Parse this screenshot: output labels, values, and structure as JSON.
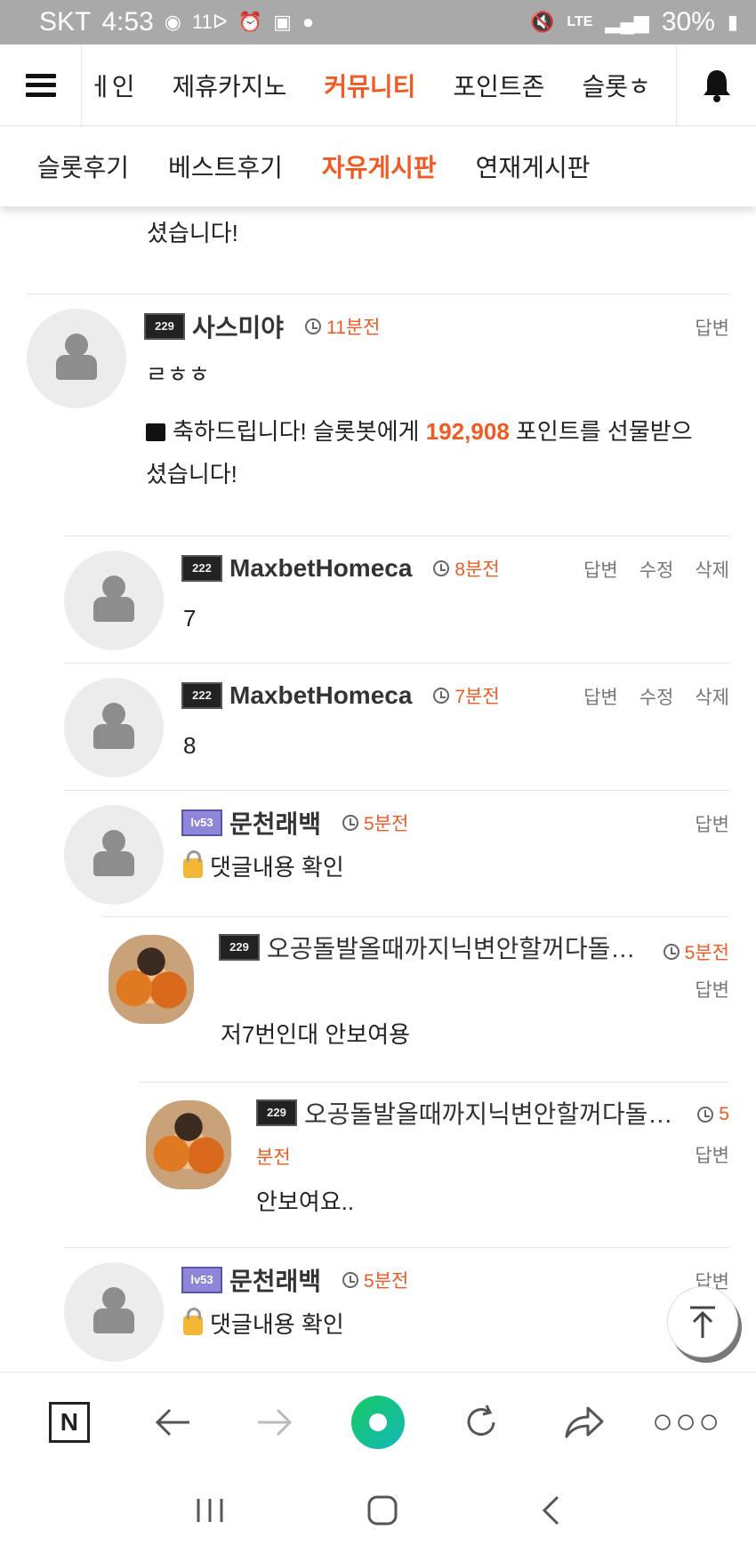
{
  "status_bar": {
    "carrier": "SKT",
    "time": "4:53",
    "extra": "11ᐅ",
    "network": "LTE",
    "battery": "30%"
  },
  "top_nav": {
    "items": [
      "ㅔ인",
      "제휴카지노",
      "커뮤니티",
      "포인트존",
      "슬롯ㅎ"
    ],
    "active": "커뮤니티"
  },
  "sub_nav": {
    "items": [
      "슬롯후기",
      "베스트후기",
      "자유게시판",
      "연재게시판"
    ],
    "active": "자유게시판"
  },
  "cut_top": {
    "line2": "셨습니다!"
  },
  "comments": [
    {
      "level_badge": "229",
      "nickname": "사스미야",
      "time": "11분전",
      "actions": [
        "답변"
      ],
      "text": "ㄹㅎㅎ",
      "gift_prefix": "축하드립니다! 슬롯봇에게 ",
      "gift_points": "192,908",
      "gift_suffix": " 포인트를 선물받으",
      "gift_line2": "셨습니다!"
    },
    {
      "level_badge": "222",
      "nickname": "MaxbetHomeca",
      "time": "8분전",
      "actions": [
        "답변",
        "수정",
        "삭제"
      ],
      "text": "7"
    },
    {
      "level_badge": "222",
      "nickname": "MaxbetHomeca",
      "time": "7분전",
      "actions": [
        "답변",
        "수정",
        "삭제"
      ],
      "text": "8"
    },
    {
      "level_badge": "lv53",
      "nickname": "문천래백",
      "time": "5분전",
      "actions": [
        "답변"
      ],
      "text": "댓글내용 확인"
    },
    {
      "level_badge": "229",
      "nickname": "오공돌발올때까지닉변안할꺼다돌…",
      "time": "5분전",
      "actions": [
        "답변"
      ],
      "text": "저7번인대 안보여용"
    },
    {
      "level_badge": "229",
      "nickname": "오공돌발올때까지닉변안할꺼다돌…",
      "time_part1": "5",
      "time_part2": "분전",
      "actions": [
        "답변"
      ],
      "text": "안보여요.."
    },
    {
      "level_badge": "lv53",
      "nickname": "문천래백",
      "time": "5분전",
      "actions": [
        "답변"
      ],
      "text": "댓글내용 확인"
    }
  ],
  "browser_bar": {
    "n_label": "N"
  },
  "colors": {
    "accent": "#f15a22",
    "status_bar": "#a9a9a9"
  },
  "icons": [
    "menu-icon",
    "bell-icon",
    "clock-icon",
    "gift-icon",
    "lock-icon",
    "arrow-up-icon",
    "back-icon",
    "forward-icon",
    "refresh-icon",
    "share-icon",
    "more-icon"
  ]
}
